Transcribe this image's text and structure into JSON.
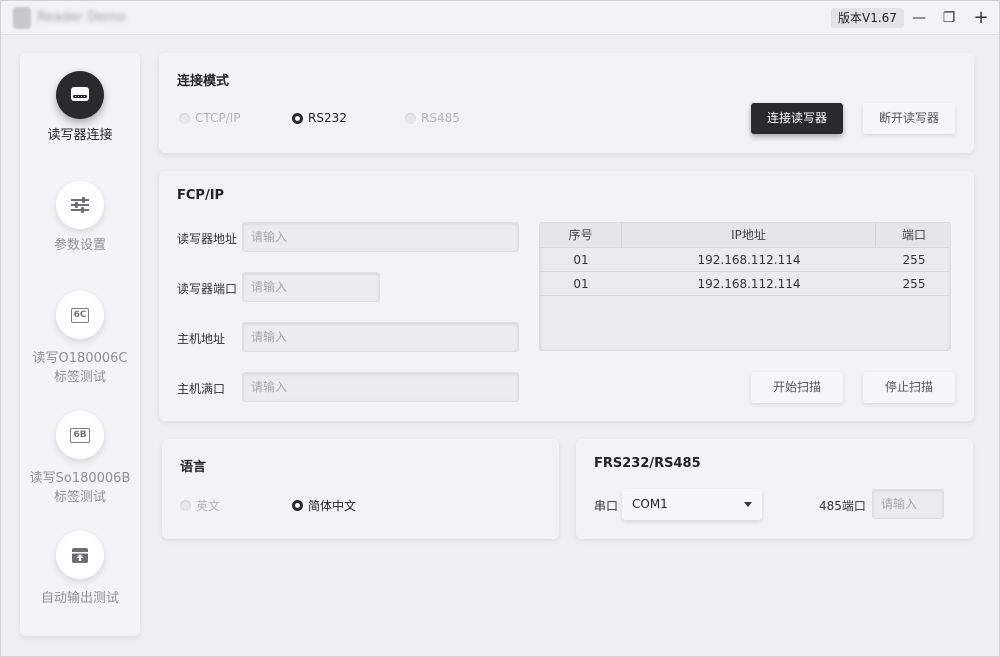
{
  "titlebar": {
    "app_title": "Reader Demo",
    "version": "版本V1.67",
    "minimize": "—",
    "restore": "❐",
    "close": "+"
  },
  "sidebar": {
    "items": [
      {
        "label": "读写器连接",
        "icon": "card-reader-icon",
        "active": true
      },
      {
        "label": "参数设置",
        "icon": "sliders-icon",
        "active": false
      },
      {
        "label_line1": "读写O180006C",
        "label_line2": "标签测试",
        "icon": "chip-6c-icon",
        "chip_text": "6C",
        "active": false
      },
      {
        "label_line1": "读写So180006B",
        "label_line2": "标签测试",
        "icon": "chip-6b-icon",
        "chip_text": "6B",
        "active": false
      },
      {
        "label": "自动输出测试",
        "icon": "upload-box-icon",
        "active": false
      }
    ]
  },
  "connect_mode": {
    "title": "连接模式",
    "options": [
      {
        "label": "CTCP/IP",
        "selected": false
      },
      {
        "label": "RS232",
        "selected": true
      },
      {
        "label": "RS485",
        "selected": false
      }
    ],
    "connect_button": "连接读写器",
    "disconnect_button": "断开读写器"
  },
  "fcp": {
    "title": "FCP/IP",
    "fields": [
      {
        "label": "读写器地址",
        "placeholder": "请输入"
      },
      {
        "label": "读写器端口",
        "placeholder": "请输入"
      },
      {
        "label": "主机地址",
        "placeholder": "请输入"
      },
      {
        "label": "主机满口",
        "placeholder": "请输入"
      }
    ],
    "table": {
      "headers": [
        "序号",
        "IP地址",
        "端口"
      ],
      "rows": [
        [
          "01",
          "192.168.112.114",
          "255"
        ],
        [
          "01",
          "192.168.112.114",
          "255"
        ]
      ]
    },
    "start_scan": "开始扫描",
    "stop_scan": "停止扫描"
  },
  "language": {
    "title": "语言",
    "options": [
      {
        "label": "英文",
        "selected": false
      },
      {
        "label": "简体中文",
        "selected": true
      }
    ]
  },
  "serial": {
    "title": "FRS232/RS485",
    "port_label": "串口",
    "port_value": "COM1",
    "port485_label": "485端口",
    "port485_placeholder": "请输入"
  },
  "colors": {
    "accent_dark": "#2a2a2c",
    "background": "#eeeef2",
    "panel": "#f3f3f6"
  }
}
